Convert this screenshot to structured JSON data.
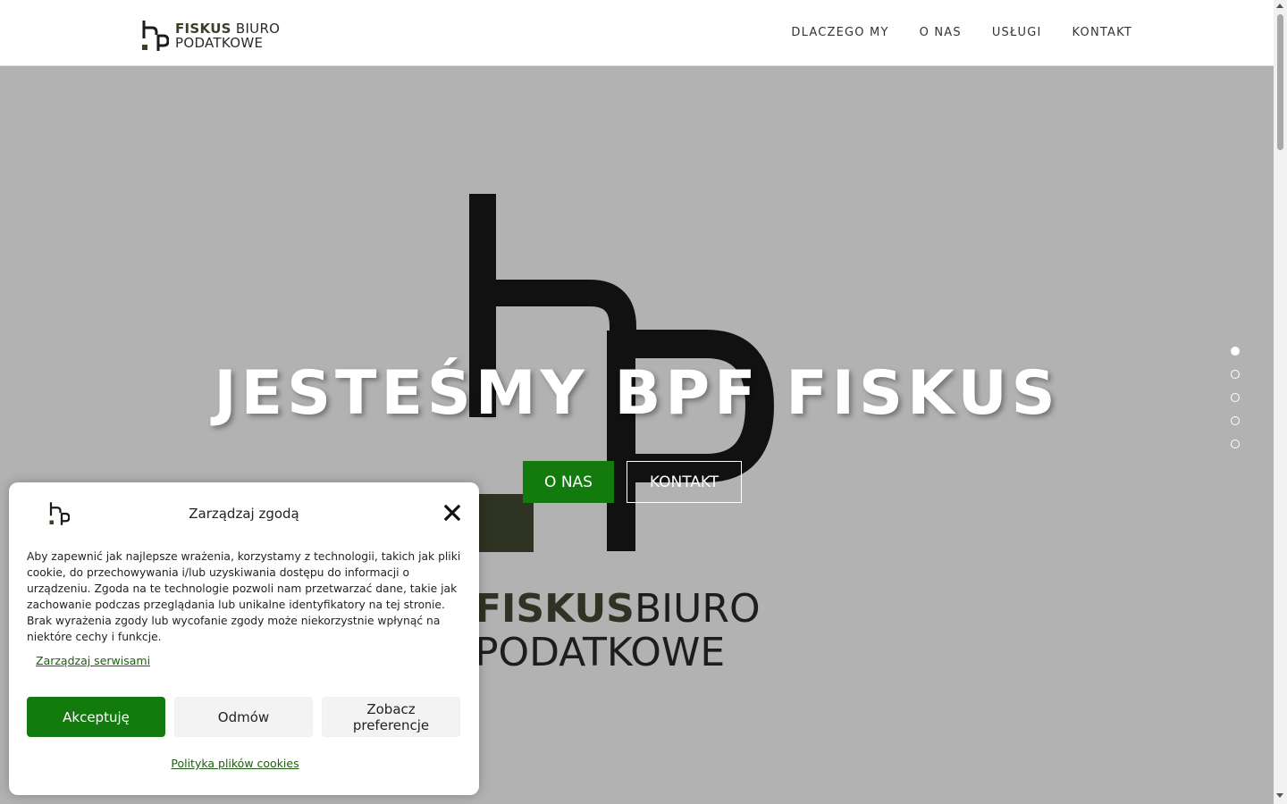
{
  "header": {
    "logo": {
      "word_bold": "FISKUS",
      "word_regular": "BIURO",
      "line2": "PODATKOWE"
    },
    "nav": [
      "DLACZEGO MY",
      "O NAS",
      "USŁUGI",
      "KONTAKT"
    ]
  },
  "hero": {
    "title": "JESTEŚMY BPF FISKUS",
    "buttons": {
      "primary": "O NAS",
      "secondary": "KONTAKT"
    },
    "art_logo": {
      "word_bold": "FISKUS",
      "word_regular": "BIURO",
      "line2": "PODATKOWE"
    },
    "slides": {
      "count": 5,
      "active_index": 0
    }
  },
  "cookie_modal": {
    "title": "Zarządzaj zgodą",
    "body": "Aby zapewnić jak najlepsze wrażenia, korzystamy z technologii, takich jak pliki cookie, do przechowywania i/lub uzyskiwania dostępu do informacji o urządzeniu. Zgoda na te technologie pozwoli nam przetwarzać dane, takie jak zachowanie podczas przeglądania lub unikalne identyfikatory na tej stronie. Brak wyrażenia zgody lub wycofanie zgody może niekorzystnie wpłynąć na niektóre cechy i funkcje.",
    "manage_link": "Zarządzaj serwisami",
    "accept": "Akceptuję",
    "deny": "Odmów",
    "preferences": "Zobacz preferencje",
    "policy_link": "Polityka plików cookies"
  },
  "colors": {
    "brand_green": "#137b0e",
    "logo_olive": "#3a4225",
    "hero_bg": "#b2b2b2"
  },
  "icons": [
    "logo-mark-icon",
    "close-icon",
    "scroll-up-arrow-icon",
    "scroll-down-arrow-icon"
  ]
}
